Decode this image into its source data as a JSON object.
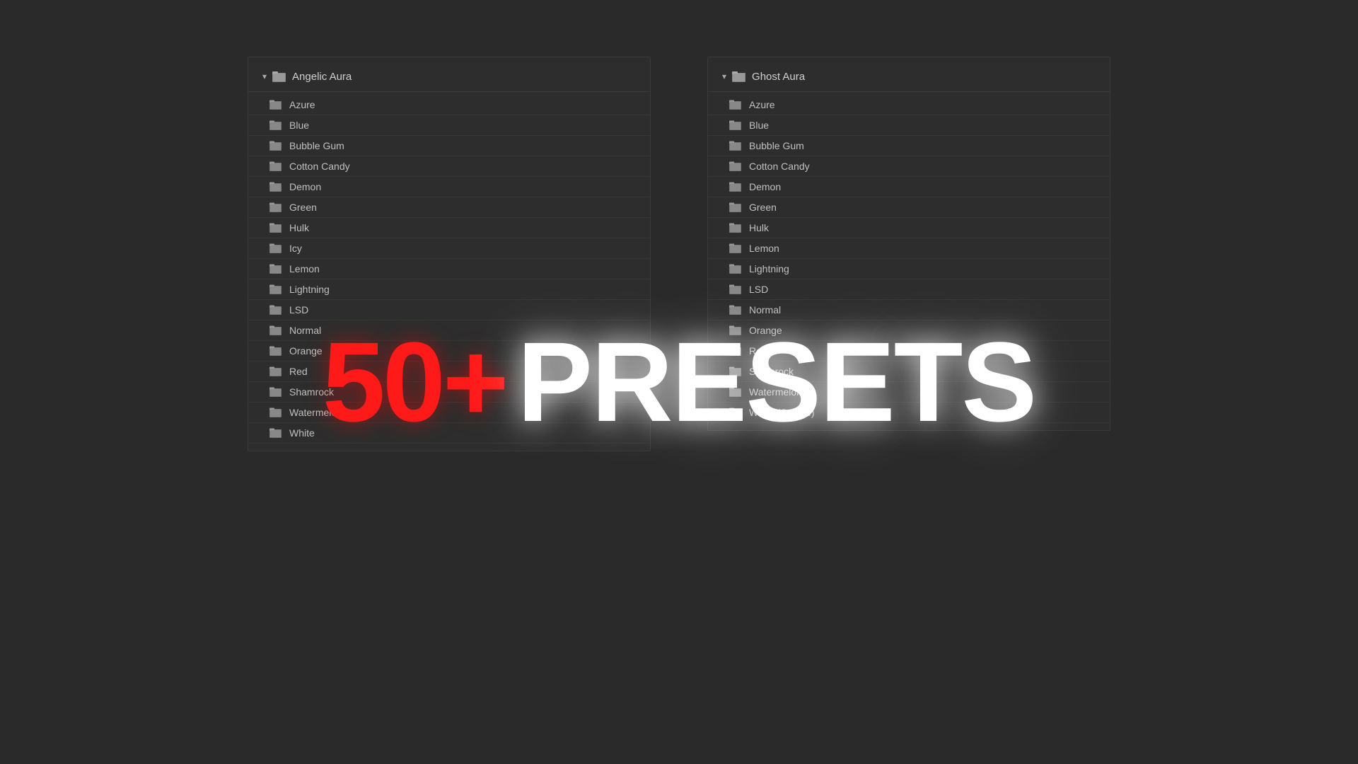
{
  "overlay": {
    "number": "50+",
    "presets_label": "PRESETS"
  },
  "left_panel": {
    "title": "Angelic Aura",
    "items": [
      "Azure",
      "Blue",
      "Bubble Gum",
      "Cotton Candy",
      "Demon",
      "Green",
      "Hulk",
      "Icy",
      "Lemon",
      "Lightning",
      "LSD",
      "Normal",
      "Orange",
      "Red",
      "Shamrock",
      "Watermelon",
      "White"
    ]
  },
  "right_panel": {
    "title": "Ghost Aura",
    "items": [
      "Azure",
      "Blue",
      "Bubble Gum",
      "Cotton Candy",
      "Demon",
      "Green",
      "Hulk",
      "Lemon",
      "Lightning",
      "LSD",
      "Normal",
      "Orange",
      "Red",
      "Shamrock",
      "Watermelon",
      "White (Smoke)"
    ]
  }
}
